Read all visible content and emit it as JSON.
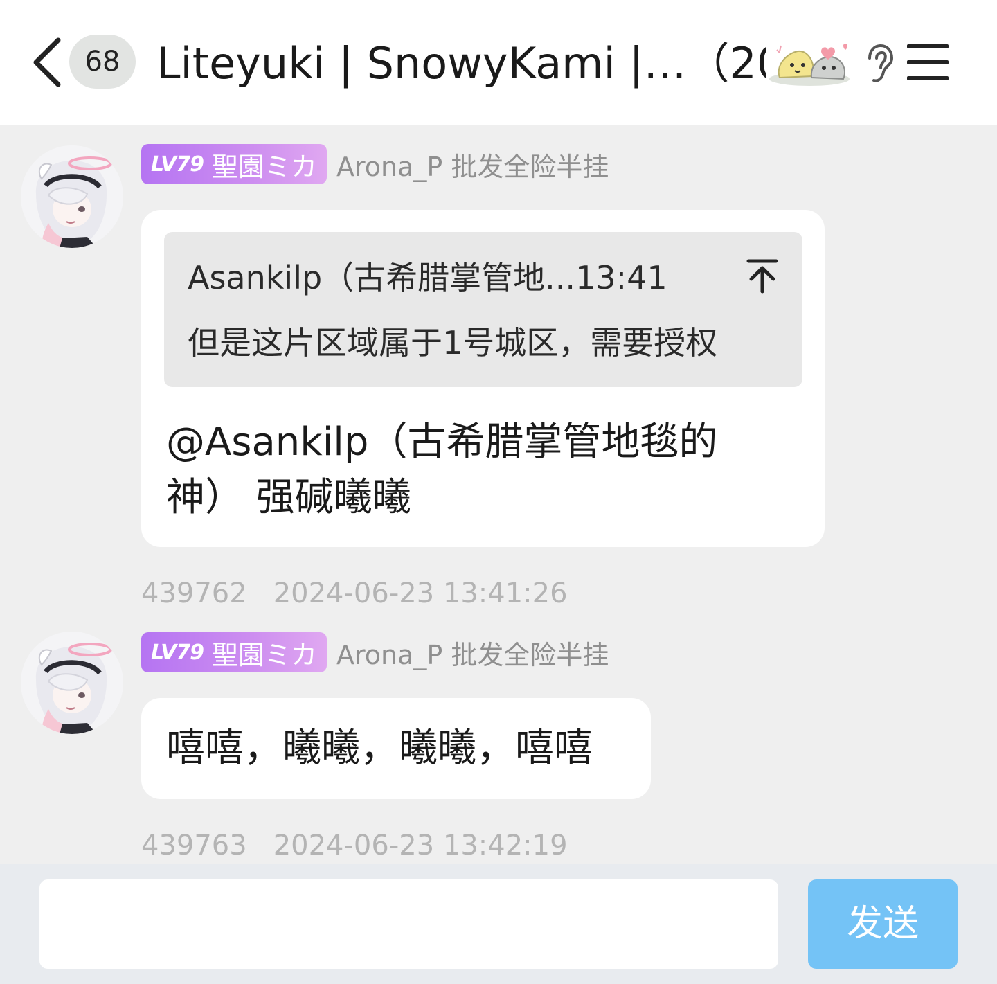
{
  "header": {
    "unread_count": "68",
    "title": "Liteyuki | SnowyKami |…（204）"
  },
  "messages": [
    {
      "sender": {
        "level": "LV79",
        "group_title": "聖園ミカ",
        "name": "Arona_P 批发全险半挂"
      },
      "quote": {
        "author_time": "Asankilp（古希腊掌管地...13:41",
        "text": "但是这片区域属于1号城区，需要授权"
      },
      "text": "@Asankilp（古希腊掌管地毯的神） 强碱曦曦",
      "id": "439762",
      "timestamp": "2024-06-23 13:41:26"
    },
    {
      "sender": {
        "level": "LV79",
        "group_title": "聖園ミカ",
        "name": "Arona_P 批发全险半挂"
      },
      "text": "嘻嘻，曦曦，曦曦，嘻嘻",
      "id": "439763",
      "timestamp": "2024-06-23 13:42:19"
    }
  ],
  "composer": {
    "input_value": "",
    "send_label": "发送"
  },
  "colors": {
    "level_badge_gradient_start": "#b574f2",
    "level_badge_gradient_end": "#e0a8f1",
    "send_button": "#74c3f6",
    "background": "#efefef"
  }
}
